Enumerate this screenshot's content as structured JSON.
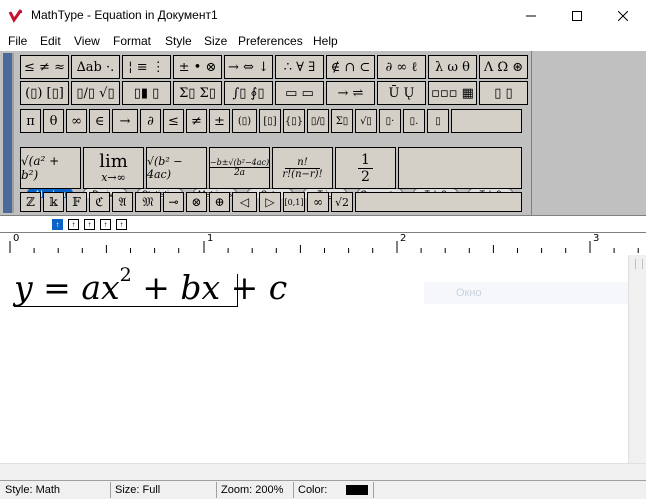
{
  "window": {
    "title": "MathType - Equation in Документ1",
    "minimize_icon": "minimize-icon",
    "maximize_icon": "maximize-icon",
    "close_icon": "close-icon"
  },
  "menu": [
    "File",
    "Edit",
    "View",
    "Format",
    "Style",
    "Size",
    "Preferences",
    "Help"
  ],
  "palette_row1": [
    "≤ ≠ ≈",
    "∆ab ·.",
    "¦ ≡ ⋮",
    "± • ⊗",
    "→ ⇔ ↓",
    "∴ ∀ ∃",
    "∉ ∩ ⊂",
    "∂ ∞ ℓ",
    "λ ω θ",
    "Λ Ω ⊛"
  ],
  "palette_row2": [
    "(▯) [▯]",
    "▯/▯ √▯",
    "▯▮ ▯",
    "Σ▯ Σ▯",
    "∫▯ ∮▯",
    "▭ ▭",
    "→ ⇌",
    "Ū Ų",
    "▫▫▫ ▦",
    "▯ ▯"
  ],
  "small_symbols": [
    "π",
    "θ",
    "∞",
    "∈",
    "→",
    "∂",
    "≤",
    "≠",
    "±",
    "(▯)",
    "[▯]",
    "{▯}",
    "▯/▯",
    "Σ▯",
    "√▯",
    "▯·",
    "▯.",
    "▯"
  ],
  "tabs": [
    "Algebra",
    "Derivs",
    "Statistics",
    "Matrices",
    "Sets",
    "Trig",
    "Geometry",
    "Tab 8",
    "Tab 9"
  ],
  "active_tab": "Algebra",
  "templates": {
    "t1": "√(a² + b²)",
    "t2_top": "lim",
    "t2_bottom": "x→∞",
    "t3": "√(b² − 4ac)",
    "t4_top": "−b±√(b²−4ac)",
    "t4_bottom": "2a",
    "t5_top": "n!",
    "t5_bottom": "r!(n−r)!",
    "t6_top": "1",
    "t6_bottom": "2"
  },
  "bottom_row": [
    "ℤ",
    "𝕜",
    "𝔽",
    "ℭ",
    "𝔄",
    "𝔐",
    "⊸",
    "⊗",
    "⊕",
    "◁",
    "▷",
    "[0,1]",
    "∞",
    "√2"
  ],
  "nudge_buttons": [
    "↑",
    "↑",
    "↑",
    "↑",
    "↑"
  ],
  "ruler_numbers": [
    "0",
    "1",
    "2",
    "3"
  ],
  "equation": {
    "y": "y",
    "eq": "=",
    "a": "a",
    "x1": "x",
    "sup": "2",
    "plus1": "+",
    "b": "b",
    "x2": "x",
    "plus2": "+",
    "c": "c"
  },
  "ghost_text": "Окно",
  "status": {
    "style": "Style: Math",
    "size": "Size: Full",
    "zoom": "Zoom: 200%",
    "color_label": "Color:",
    "color_swatch": "#000000"
  },
  "colors": {
    "accent": "#0a64c8",
    "app_icon": "#c8102e"
  }
}
